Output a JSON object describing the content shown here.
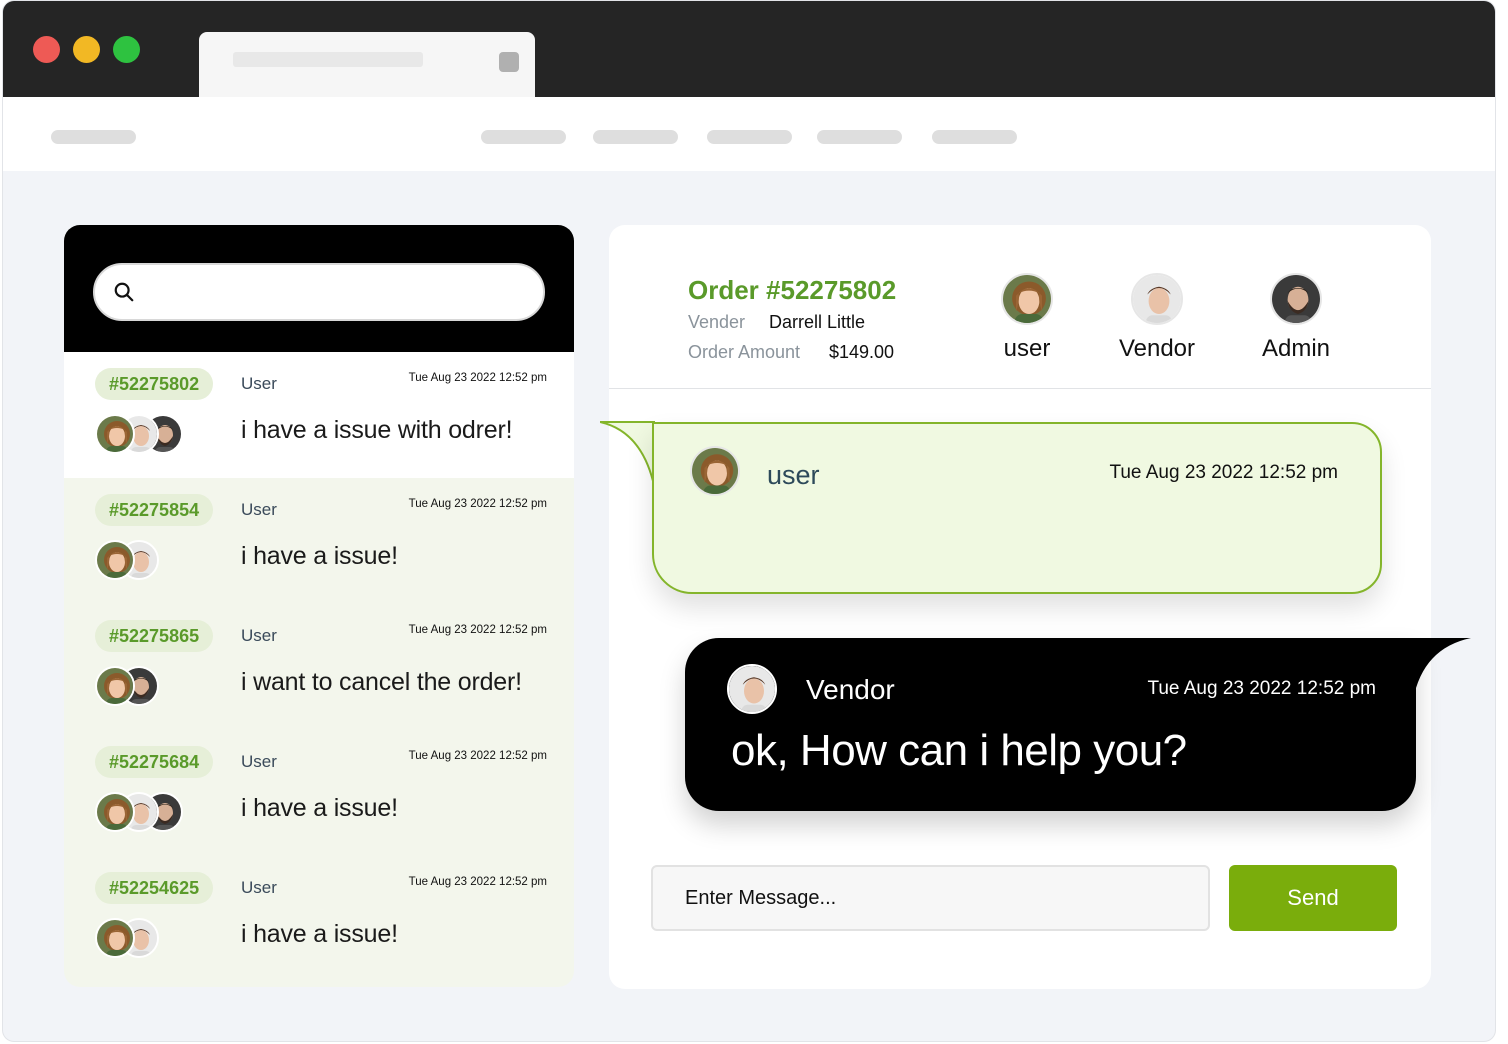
{
  "conversations": [
    {
      "id": "#52275802",
      "role": "User",
      "time": "Tue Aug 23 2022 12:52 pm",
      "message": "i have a issue with odrer!",
      "avatars": [
        "woman",
        "man",
        "bearded"
      ]
    },
    {
      "id": "#52275854",
      "role": "User",
      "time": "Tue Aug 23 2022 12:52 pm",
      "message": "i have a issue!",
      "avatars": [
        "woman",
        "man"
      ]
    },
    {
      "id": "#52275865",
      "role": "User",
      "time": "Tue Aug 23 2022 12:52 pm",
      "message": "i want to cancel the order!",
      "avatars": [
        "woman",
        "bearded"
      ]
    },
    {
      "id": "#52275684",
      "role": "User",
      "time": "Tue Aug 23 2022 12:52 pm",
      "message": "i have a issue!",
      "avatars": [
        "woman",
        "man",
        "bearded"
      ]
    },
    {
      "id": "#52254625",
      "role": "User",
      "time": "Tue Aug 23 2022 12:52 pm",
      "message": "i have a issue!",
      "avatars": [
        "woman",
        "man"
      ]
    }
  ],
  "order": {
    "title": "Order #52275802",
    "vendor_label": "Vender",
    "vendor_name": "Darrell Little",
    "amount_label": "Order Amount",
    "amount": "$149.00"
  },
  "participants": [
    {
      "label": "user"
    },
    {
      "label": "Vendor"
    },
    {
      "label": "Admin"
    }
  ],
  "messages": [
    {
      "sender": "user",
      "time": "Tue Aug 23 2022 12:52 pm",
      "text": ""
    },
    {
      "sender": "Vendor",
      "time": "Tue Aug 23 2022 12:52 pm",
      "text": "ok, How can i help you?"
    }
  ],
  "composer": {
    "placeholder": "Enter Message...",
    "send_label": "Send"
  },
  "colors": {
    "accent_green": "#7aad0c",
    "id_green": "#5a9a2a",
    "user_bubble_bg": "#f0f9e1",
    "user_bubble_border": "#84b52b",
    "vendor_bubble_bg": "#000000",
    "list_bg": "#f3f6ec"
  }
}
